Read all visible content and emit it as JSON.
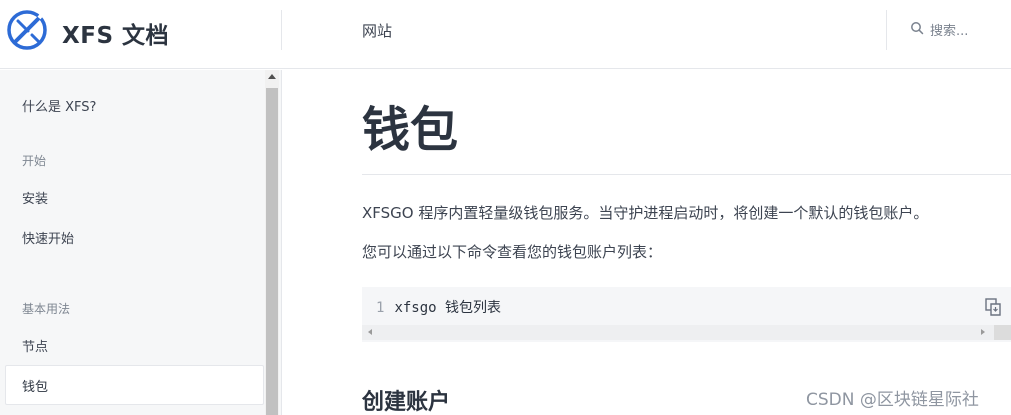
{
  "header": {
    "site_title": "XFS 文档",
    "nav_link": "网站",
    "search_placeholder": "搜索..."
  },
  "sidebar": {
    "items": [
      {
        "label": "什么是 XFS?",
        "kind": "link"
      },
      {
        "label": "开始",
        "kind": "section"
      },
      {
        "label": "安装",
        "kind": "link"
      },
      {
        "label": "快速开始",
        "kind": "link"
      },
      {
        "label": "基本用法",
        "kind": "section"
      },
      {
        "label": "节点",
        "kind": "link"
      },
      {
        "label": "钱包",
        "kind": "link",
        "active": true
      }
    ]
  },
  "main": {
    "title": "钱包",
    "paragraphs": [
      "XFSGO 程序内置轻量级钱包服务。当守护进程启动时，将创建一个默认的钱包账户。",
      "您可以通过以下命令查看您的钱包账户列表："
    ],
    "code": {
      "line_number": "1",
      "text": "xfsgo 钱包列表"
    },
    "section_heading": "创建账户"
  },
  "watermark": "CSDN @区块链星际社",
  "colors": {
    "logo_blue": "#2d6bd6",
    "sidebar_bg": "#f6f7f8",
    "code_bg": "#f5f6f8"
  },
  "icons": [
    "xfs-logo-icon",
    "search-icon",
    "copy-icon"
  ]
}
